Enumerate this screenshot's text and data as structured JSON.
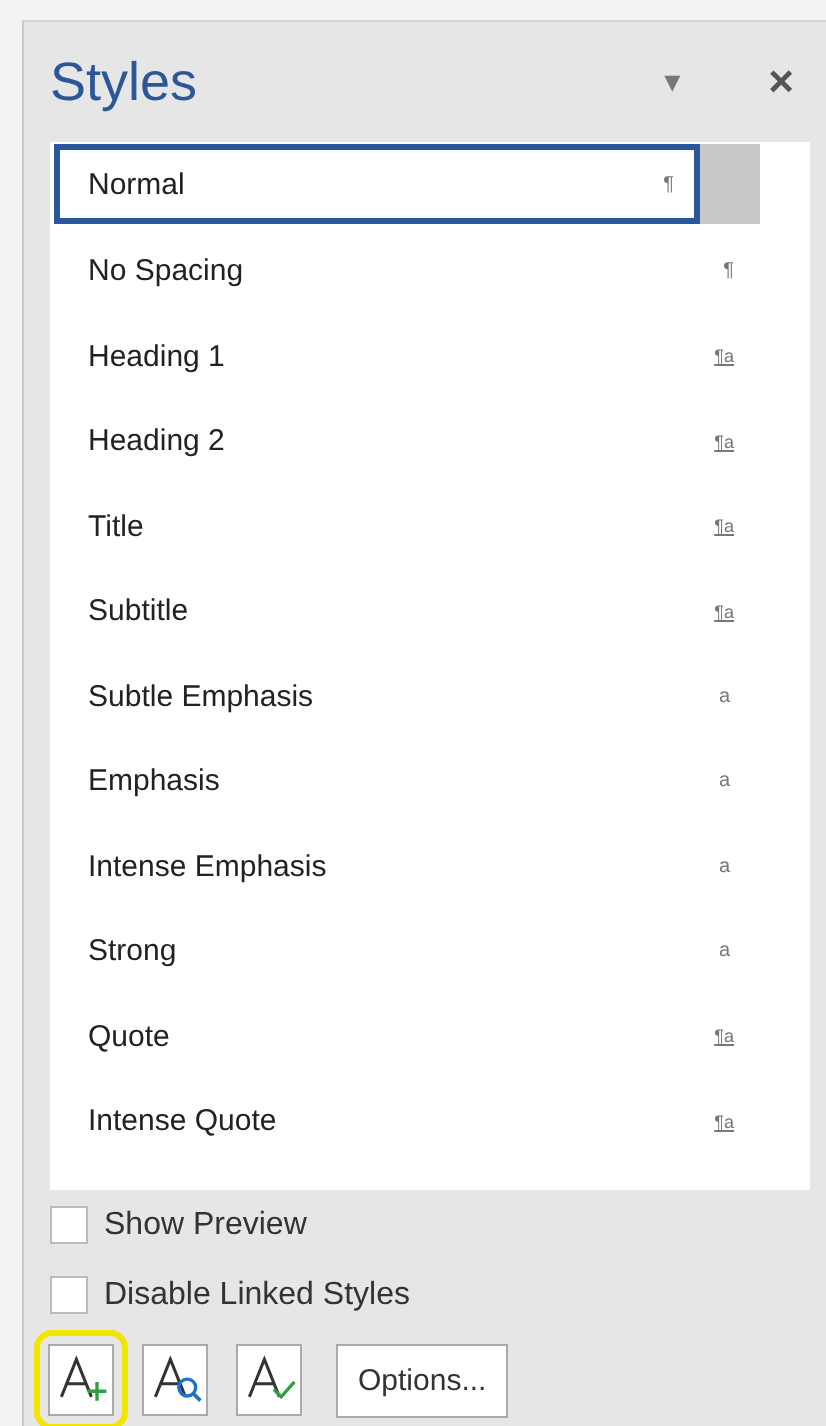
{
  "pane": {
    "title": "Styles",
    "menu_caret": "▾",
    "close": "×"
  },
  "styles": [
    {
      "name": "Normal",
      "kind": "paragraph",
      "mark": "¶",
      "selected": true
    },
    {
      "name": "No Spacing",
      "kind": "paragraph",
      "mark": "¶",
      "selected": false
    },
    {
      "name": "Heading 1",
      "kind": "linked",
      "mark": "¶a",
      "selected": false
    },
    {
      "name": "Heading 2",
      "kind": "linked",
      "mark": "¶a",
      "selected": false
    },
    {
      "name": "Title",
      "kind": "linked",
      "mark": "¶a",
      "selected": false
    },
    {
      "name": "Subtitle",
      "kind": "linked",
      "mark": "¶a",
      "selected": false
    },
    {
      "name": "Subtle Emphasis",
      "kind": "character",
      "mark": "a",
      "selected": false
    },
    {
      "name": "Emphasis",
      "kind": "character",
      "mark": "a",
      "selected": false
    },
    {
      "name": "Intense Emphasis",
      "kind": "character",
      "mark": "a",
      "selected": false
    },
    {
      "name": "Strong",
      "kind": "character",
      "mark": "a",
      "selected": false
    },
    {
      "name": "Quote",
      "kind": "linked",
      "mark": "¶a",
      "selected": false
    },
    {
      "name": "Intense Quote",
      "kind": "linked",
      "mark": "¶a",
      "selected": false
    }
  ],
  "options": [
    {
      "label": "Show Preview",
      "checked": false
    },
    {
      "label": "Disable Linked Styles",
      "checked": false
    }
  ],
  "tool_buttons": [
    {
      "kind": "new",
      "highlighted": true
    },
    {
      "kind": "inspect",
      "highlighted": false
    },
    {
      "kind": "manage",
      "highlighted": false
    }
  ],
  "options_button": "Options..."
}
